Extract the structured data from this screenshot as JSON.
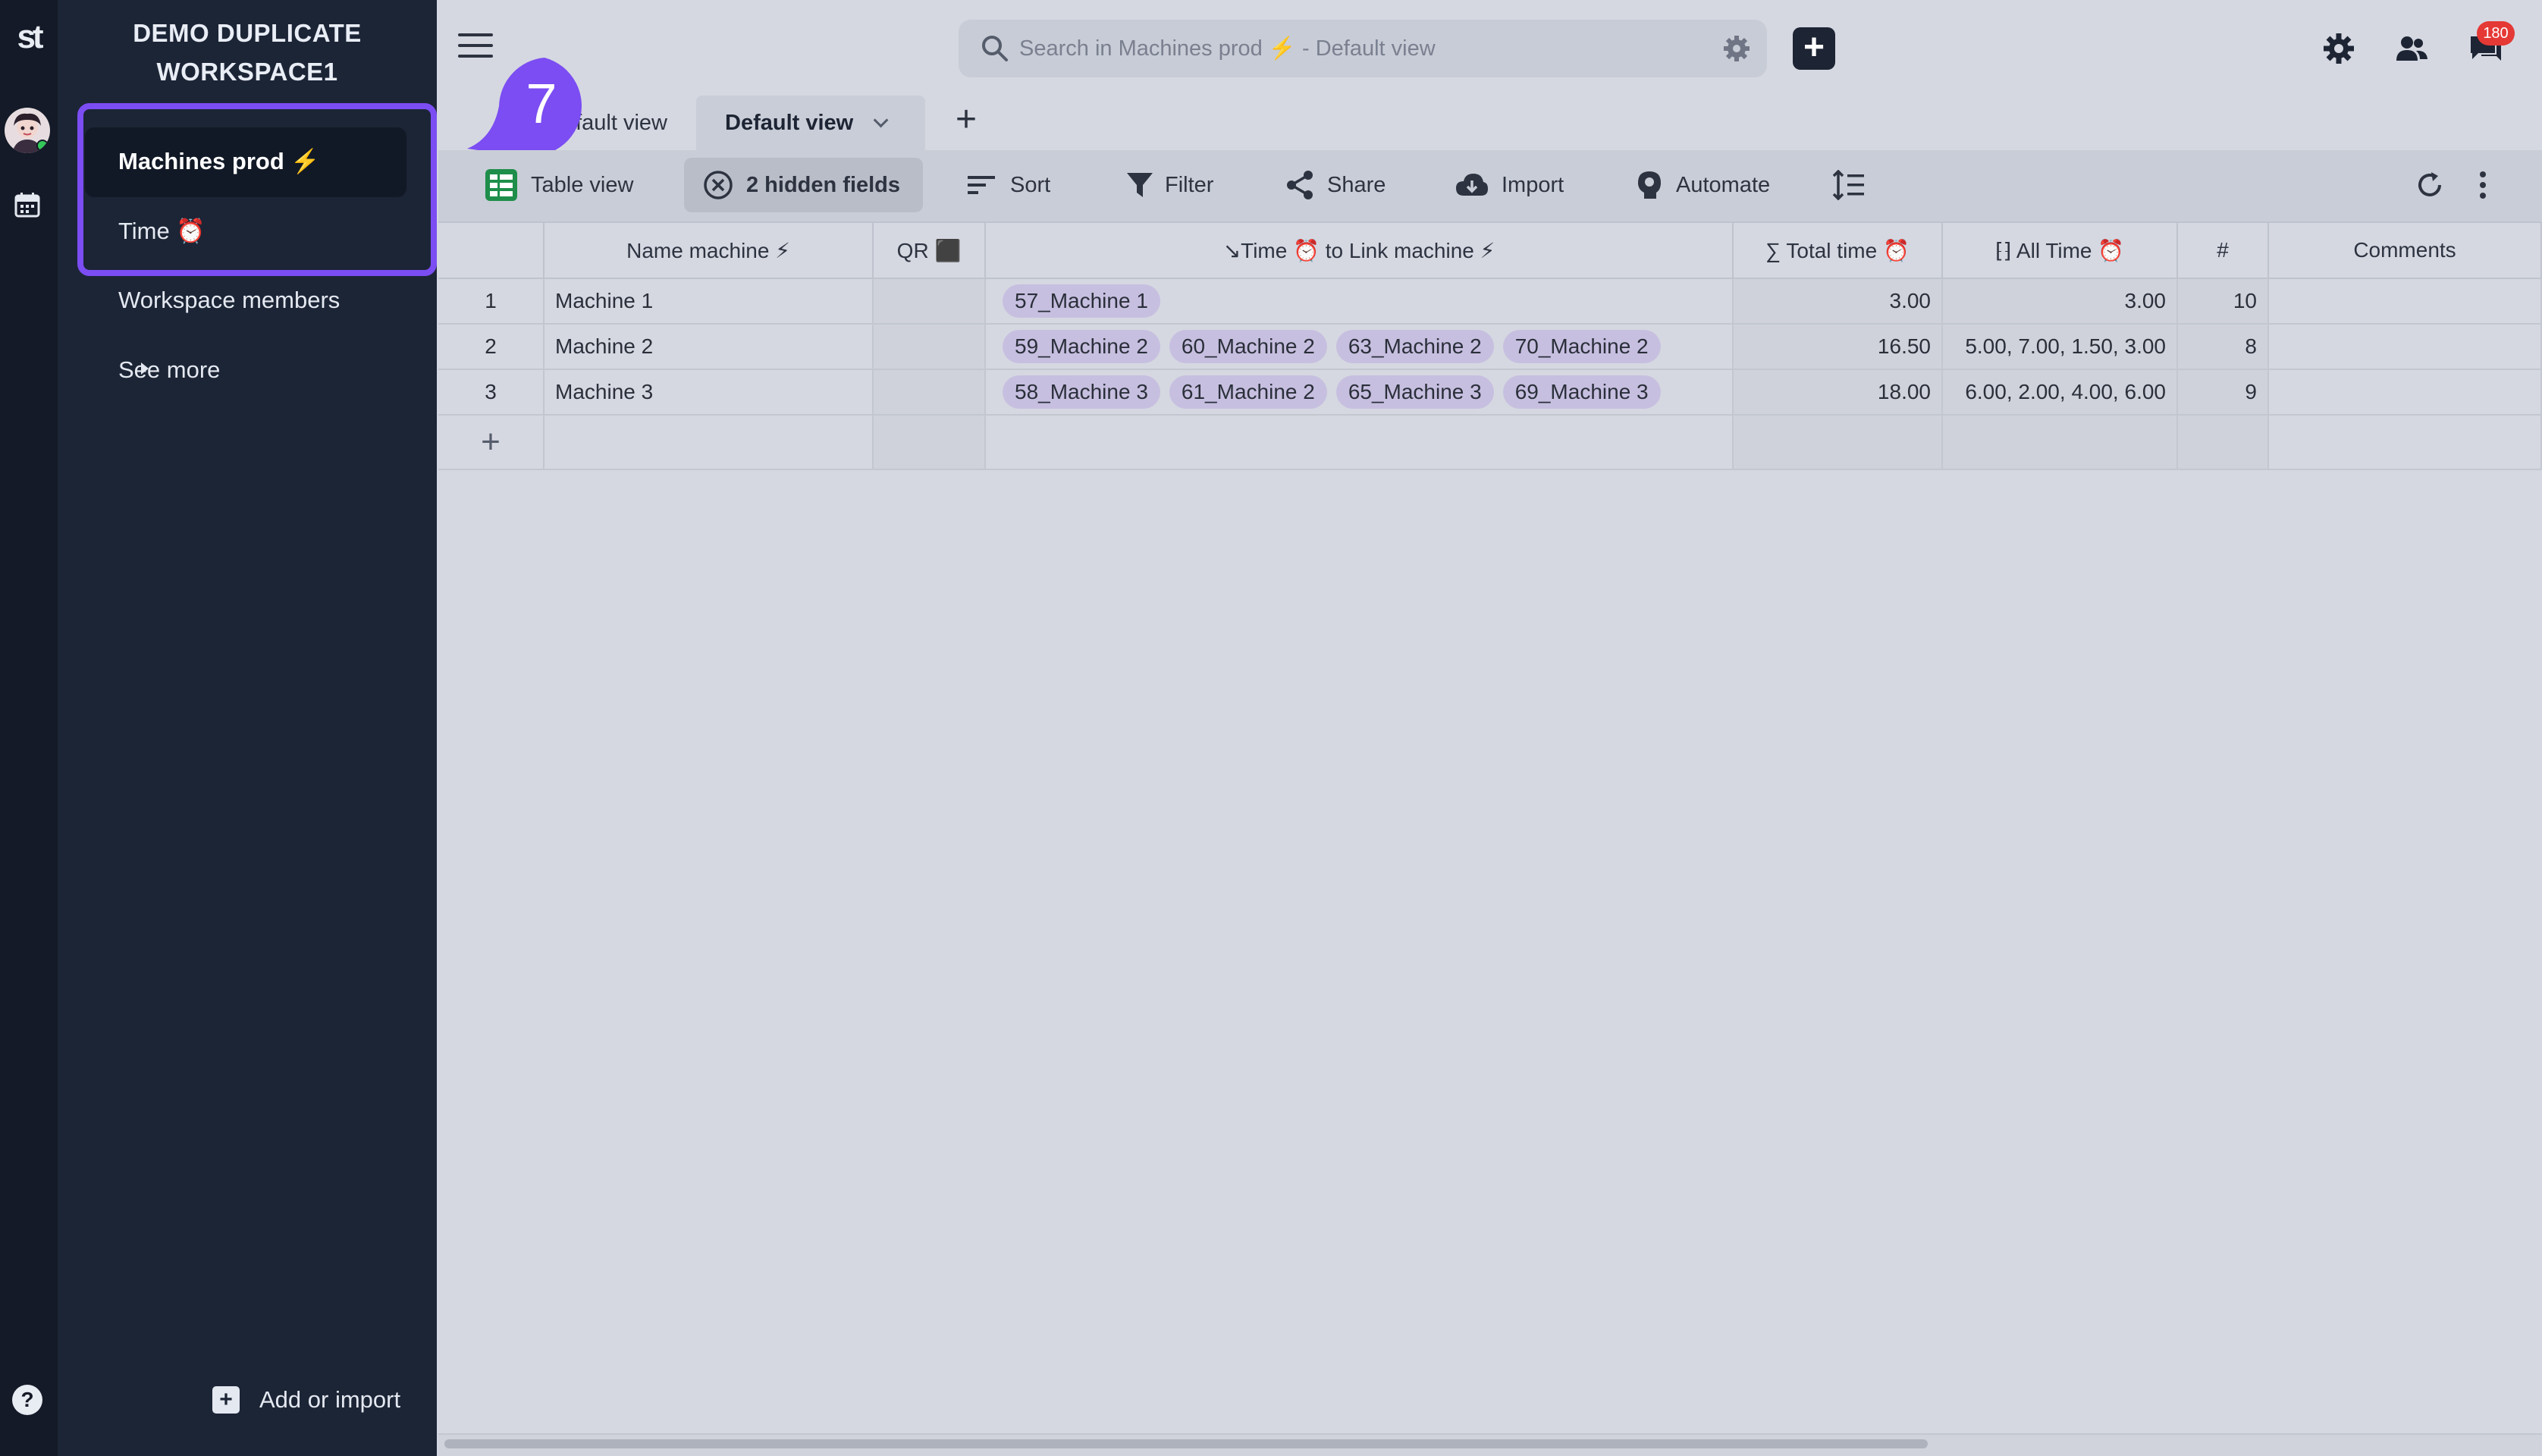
{
  "workspace": {
    "title_line1": "DEMO DUPLICATE",
    "title_line2": "WORKSPACE1"
  },
  "sidebar": {
    "items": [
      {
        "label": "Machines prod ⚡",
        "active": true
      },
      {
        "label": "Time ⏰",
        "active": false
      },
      {
        "label": "Workspace members",
        "active": false
      },
      {
        "label": "See more",
        "active": false
      }
    ],
    "add_import": "Add or import"
  },
  "rail": {
    "logo": "st",
    "help": "?"
  },
  "step_badge": "7",
  "search": {
    "placeholder": "Search in Machines prod ⚡ - Default view"
  },
  "notifications": {
    "count": "180"
  },
  "tabs": [
    {
      "label": "Default view",
      "active": false
    },
    {
      "label": "Default view",
      "active": true
    }
  ],
  "toolbar": {
    "table_view": "Table view",
    "hidden_fields": "2 hidden fields",
    "sort": "Sort",
    "filter": "Filter",
    "share": "Share",
    "import": "Import",
    "automate": "Automate"
  },
  "table": {
    "columns": [
      "Name machine ⚡",
      "QR ⬛",
      "↘Time ⏰ to Link machine ⚡",
      "∑ Total time ⏰",
      "⁅⁆ All Time ⏰",
      "#",
      "Comments"
    ],
    "rows": [
      {
        "index": "1",
        "name": "Machine 1",
        "links": [
          "57_Machine 1"
        ],
        "total": "3.00",
        "all": "3.00",
        "num": "10",
        "comments": ""
      },
      {
        "index": "2",
        "name": "Machine 2",
        "links": [
          "59_Machine 2",
          "60_Machine 2",
          "63_Machine 2",
          "70_Machine 2"
        ],
        "total": "16.50",
        "all": "5.00, 7.00, 1.50, 3.00",
        "num": "8",
        "comments": ""
      },
      {
        "index": "3",
        "name": "Machine 3",
        "links": [
          "58_Machine 3",
          "61_Machine 2",
          "65_Machine 3",
          "69_Machine 3"
        ],
        "total": "18.00",
        "all": "6.00, 2.00, 4.00, 6.00",
        "num": "9",
        "comments": ""
      }
    ],
    "add_row": "+"
  },
  "colors": {
    "accent": "#7b4df2",
    "sidebar_bg": "#1c2536",
    "rail_bg": "#141a27",
    "chip_bg": "#c7bfe0",
    "badge_red": "#e53935"
  }
}
